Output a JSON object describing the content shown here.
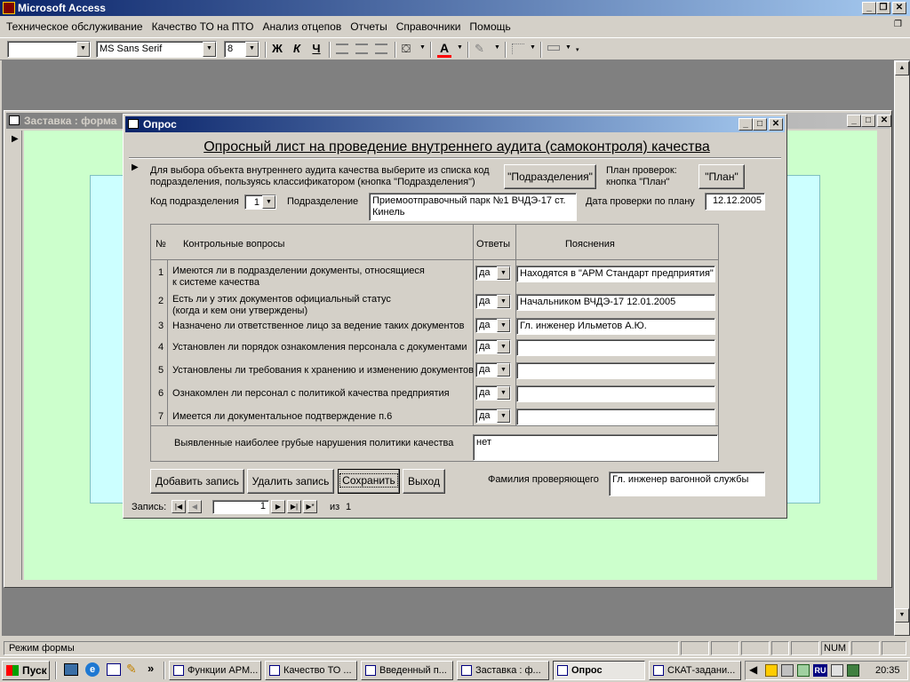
{
  "app": {
    "title": "Microsoft Access"
  },
  "menu": [
    "Техническое обслуживание",
    "Качество ТО на ПТО",
    "Анализ отцепов",
    "Отчеты",
    "Справочники",
    "Помощь"
  ],
  "format_toolbar": {
    "object_value": "",
    "font_name": "MS Sans Serif",
    "font_size": "8",
    "bold": "Ж",
    "italic": "К",
    "underline": "Ч",
    "font_color_letter": "A"
  },
  "splash_window": {
    "title": "Заставка : форма"
  },
  "form": {
    "title": "Опрос",
    "heading": "Опросный лист на проведение внутреннего аудита (самоконтроля) качества",
    "instruction_line1": "Для выбора объекта внутреннего аудита качества выберите из списка код",
    "instruction_line2": "подразделения, пользуясь классификатором (кнопка \"Подразделения\")",
    "divisions_button": "\"Подразделения\"",
    "plan_caption_line1": "План проверок:",
    "plan_caption_line2": "кнопка \"План\"",
    "plan_button": "\"План\"",
    "division_code_label": "Код подразделения",
    "division_code_value": "1",
    "division_label": "Подразделение",
    "division_value_line1": "Приемоотправочный парк №1 ВЧДЭ-17 ст.",
    "division_value_line2": "Кинель",
    "plan_date_label": "Дата проверки по плану",
    "plan_date_value": "12.12.2005",
    "table": {
      "col_num": "№",
      "col_questions": "Контрольные вопросы",
      "col_answers": "Ответы",
      "col_notes": "Пояснения",
      "rows": [
        {
          "num": "1",
          "q1": "Имеются ли в подразделении документы, относящиеся",
          "q2": "к системе качества",
          "answer": "да",
          "note": "Находятся в \"АРМ Стандарт предприятия\""
        },
        {
          "num": "2",
          "q1": "Есть ли у этих документов официальный статус",
          "q2": "(когда и кем они утверждены)",
          "answer": "да",
          "note": "Начальником ВЧДЭ-17 12.01.2005"
        },
        {
          "num": "3",
          "q1": "Назначено ли ответственное лицо за ведение таких документов",
          "q2": "",
          "answer": "да",
          "note": "Гл. инженер Ильметов А.Ю."
        },
        {
          "num": "4",
          "q1": "Установлен ли порядок ознакомления персонала с документами",
          "q2": "",
          "answer": "да",
          "note": ""
        },
        {
          "num": "5",
          "q1": "Установлены ли требования к хранению и изменению документов",
          "q2": "",
          "answer": "да",
          "note": ""
        },
        {
          "num": "6",
          "q1": "Ознакомлен ли персонал с политикой качества предприятия",
          "q2": "",
          "answer": "да",
          "note": ""
        },
        {
          "num": "7",
          "q1": "Имеется ли документальное подтверждение п.6",
          "q2": "",
          "answer": "да",
          "note": ""
        }
      ],
      "violations_label": "Выявленные наиболее грубые нарушения политики качества",
      "violations_value": "нет"
    },
    "buttons": {
      "add": "Добавить запись",
      "delete": "Удалить запись",
      "save": "Сохранить",
      "exit": "Выход"
    },
    "inspector_label": "Фамилия проверяющего",
    "inspector_value": "Гл. инженер вагонной службы",
    "record_nav": {
      "label": "Запись:",
      "current": "1",
      "of_label": "из",
      "total": "1"
    }
  },
  "status": {
    "mode": "Режим формы",
    "num": "NUM"
  },
  "taskbar": {
    "start": "Пуск",
    "chevron": "»",
    "tasks": [
      "Функции АРМ...",
      "Качество ТО ...",
      "Введенный п...",
      "Заставка : ф...",
      "Опрос",
      "СКАТ-задани..."
    ],
    "active_task": 4,
    "lang": "RU",
    "clock": "20:35"
  },
  "colors": {
    "titlebar": "#0a246a",
    "splash_bg": "#ccffcc",
    "splash_inner": "#ccffff",
    "desktop": "#808080"
  }
}
